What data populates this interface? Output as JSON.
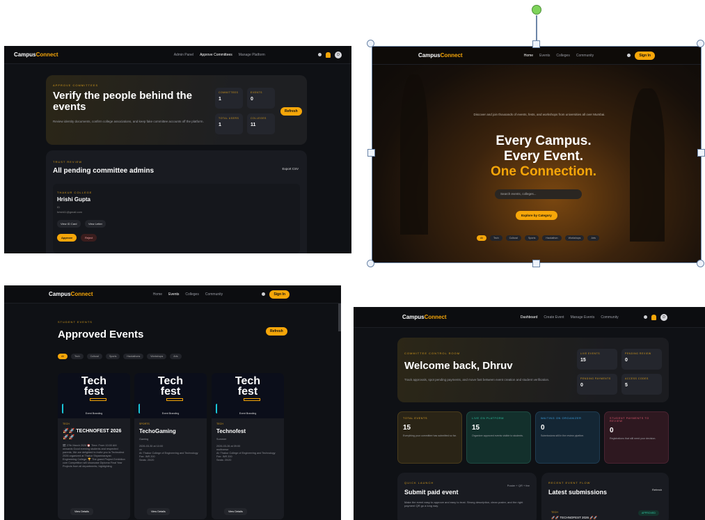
{
  "brand": {
    "pre": "Campus",
    "post": "Connect"
  },
  "p1": {
    "links": [
      "Admin Panel",
      "Approve Committees",
      "Manage Platform"
    ],
    "avatar": "D",
    "eyebrow": "APPROVE COMMITTEES",
    "title": "Verify the people behind the events",
    "desc": "Review identity documents, confirm college associations, and keep fake committee accounts off the platform.",
    "stats": [
      {
        "k": "COMMITTEES",
        "v": "1"
      },
      {
        "k": "EVENTS",
        "v": "0"
      },
      {
        "k": "TOTAL USERS",
        "v": "1"
      },
      {
        "k": "COLLEGES",
        "v": "11"
      }
    ],
    "refresh": "Refresh",
    "review_eyebrow": "TRUST REVIEW",
    "review_title": "All pending committee admins",
    "export": "Export CSV",
    "admin_college": "THAKUR COLLEGE",
    "admin_name": "Hrishi Gupta",
    "admin_line2": "ID",
    "admin_email": "hrishi11@gmail.com",
    "btn_id": "View ID Card",
    "btn_letter": "View Letter",
    "btn_approve": "Approve",
    "btn_reject": "Reject"
  },
  "p2": {
    "links": [
      "Home",
      "Events",
      "Colleges",
      "Community"
    ],
    "signin": "Sign In",
    "tagline": "Discover and join thousands of events, fests, and workshops from universities all over Mumbai.",
    "h1": "Every Campus.",
    "h2": "Every Event.",
    "h3": "One Connection.",
    "search_placeholder": "Search events, colleges...",
    "explore": "Explore by Category",
    "chips": [
      "All",
      "Tech",
      "Cultural",
      "Sports",
      "Hackathon",
      "Workshops",
      "Arts"
    ]
  },
  "p3": {
    "links": [
      "Home",
      "Events",
      "Colleges",
      "Community"
    ],
    "signin": "Sign In",
    "eyebrow": "STUDENT EVENTS",
    "title": "Approved Events",
    "refresh": "Refresh",
    "chips": [
      "All",
      "Tech",
      "Cultural",
      "Sports",
      "Hackathons",
      "Workshops",
      "Arts"
    ],
    "poster_title": "Tech\nfest",
    "poster_brand": "Event Branding",
    "events": [
      {
        "cat": "TECH",
        "title": "🚀🚀 TECHNOFEST 2026 🚀🚀",
        "sub": "🗓 27th March 2026 ⏰ Time: From 10:00 AM onwards Good evening students and respected parents. We are delighted to invite you to Technofest 2026 organized at Thakur Shyamnarayan Engineering College. 🏆 The grand Project Exhibition cum Competition will showcase Diploma Final Year Projects from all departments, highlighting",
        "btn": "View Details"
      },
      {
        "cat": "SPORTS",
        "title": "TechoGaming",
        "sub": "Gaming\n\n2026-03-30 at 10:00\nxx\nAt: Thakur College of Engineering and Technology\nFee: INR 200\nSeats: 20/20",
        "btn": "View Details"
      },
      {
        "cat": "TECH",
        "title": "Technofest",
        "sub": "Summer\n\n2026-03-26 at 09:00\nmultiverse\nAt: Thakur College of Engineering and Technology\nFee: INR 200\nSeats: 20/20",
        "btn": "View Details"
      }
    ]
  },
  "p4": {
    "links": [
      "Dashboard",
      "Create Event",
      "Manage Events",
      "Community"
    ],
    "avatar": "D",
    "eyebrow": "COMMITTEE CONTROL ROOM",
    "title": "Welcome back, Dhruv",
    "desc": "Track approvals, spot pending payments, and move fast between event creation and student verification.",
    "stats": [
      {
        "k": "LIVE EVENTS",
        "v": "15"
      },
      {
        "k": "PENDING REVIEW",
        "v": "0"
      },
      {
        "k": "PENDING PAYMENTS",
        "v": "0"
      },
      {
        "k": "ACCESS CODES",
        "v": "5"
      }
    ],
    "metrics": [
      {
        "k": "TOTAL EVENTS",
        "v": "15",
        "d": "Everything your committee has submitted so far.",
        "bg": "#2a2416",
        "accent": "#e0a52a"
      },
      {
        "k": "LIVE ON PLATFORM",
        "v": "15",
        "d": "Organizer approved events visible to students.",
        "bg": "#13302c",
        "accent": "#2fc7a5"
      },
      {
        "k": "WAITING ON ORGANIZER",
        "v": "0",
        "d": "Submissions still in the review pipeline.",
        "bg": "#142634",
        "accent": "#3ea6e6"
      },
      {
        "k": "STUDENT PAYMENTS TO REVIEW",
        "v": "0",
        "d": "Registrations that still need your decision.",
        "bg": "#2e1820",
        "accent": "#e0596f"
      }
    ],
    "quick_eyebrow": "QUICK LAUNCH",
    "quick_title": "Submit paid event",
    "quick_meta": "Poster + QR + fee",
    "quick_desc": "Make the event easy to approve and easy to trust. Strong description, clean poster, and the right payment QR go a long way.",
    "recent_eyebrow": "RECENT EVENT FLOW",
    "recent_title": "Latest submissions",
    "recent_refresh": "Refresh",
    "recent_tag": "TECH",
    "recent_item": "🚀🚀 TECHNOFEST 2026 🚀🚀",
    "recent_status": "APPROVED"
  }
}
